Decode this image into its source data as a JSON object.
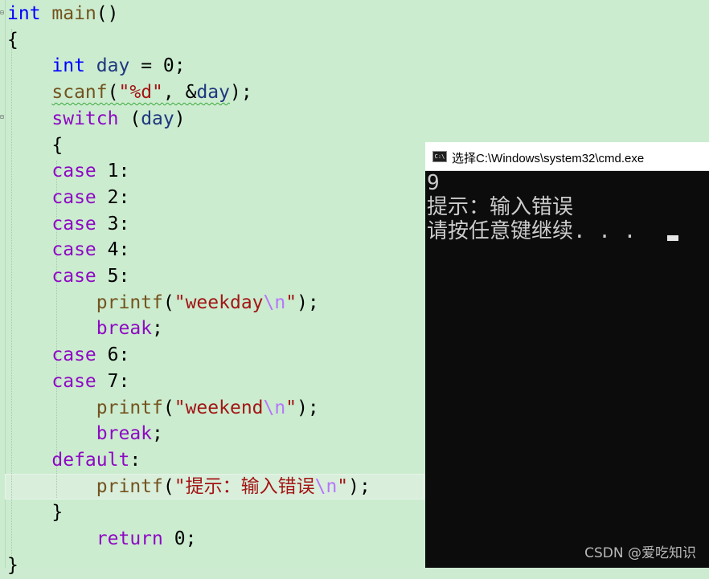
{
  "editor": {
    "lines": [
      [
        {
          "t": "int",
          "c": "kw-blue"
        },
        {
          "t": " "
        },
        {
          "t": "main",
          "c": "fn"
        },
        {
          "t": "()"
        }
      ],
      [
        {
          "t": "{"
        }
      ],
      [
        {
          "t": "    "
        },
        {
          "t": "int",
          "c": "kw-blue"
        },
        {
          "t": " "
        },
        {
          "t": "day",
          "c": "var"
        },
        {
          "t": " = 0;"
        }
      ],
      [
        {
          "t": "    "
        },
        {
          "t": "scanf",
          "c": "fn squiggle"
        },
        {
          "t": "(",
          "c": "squiggle"
        },
        {
          "t": "\"%d\"",
          "c": "str squiggle"
        },
        {
          "t": ", &",
          "c": "squiggle"
        },
        {
          "t": "day",
          "c": "var squiggle"
        },
        {
          "t": ");"
        }
      ],
      [
        {
          "t": "    "
        },
        {
          "t": "switch",
          "c": "kw-purple"
        },
        {
          "t": " ("
        },
        {
          "t": "day",
          "c": "var"
        },
        {
          "t": ")"
        }
      ],
      [
        {
          "t": "    {"
        }
      ],
      [
        {
          "t": "    "
        },
        {
          "t": "case",
          "c": "kw-purple"
        },
        {
          "t": " 1:"
        }
      ],
      [
        {
          "t": "    "
        },
        {
          "t": "case",
          "c": "kw-purple"
        },
        {
          "t": " 2:"
        }
      ],
      [
        {
          "t": "    "
        },
        {
          "t": "case",
          "c": "kw-purple"
        },
        {
          "t": " 3:"
        }
      ],
      [
        {
          "t": "    "
        },
        {
          "t": "case",
          "c": "kw-purple"
        },
        {
          "t": " 4:"
        }
      ],
      [
        {
          "t": "    "
        },
        {
          "t": "case",
          "c": "kw-purple"
        },
        {
          "t": " 5:"
        }
      ],
      [
        {
          "t": "        "
        },
        {
          "t": "printf",
          "c": "fn"
        },
        {
          "t": "("
        },
        {
          "t": "\"weekday",
          "c": "str"
        },
        {
          "t": "\\n",
          "c": "esc"
        },
        {
          "t": "\"",
          "c": "str"
        },
        {
          "t": ");"
        }
      ],
      [
        {
          "t": "        "
        },
        {
          "t": "break",
          "c": "kw-purple"
        },
        {
          "t": ";"
        }
      ],
      [
        {
          "t": "    "
        },
        {
          "t": "case",
          "c": "kw-purple"
        },
        {
          "t": " 6:"
        }
      ],
      [
        {
          "t": "    "
        },
        {
          "t": "case",
          "c": "kw-purple"
        },
        {
          "t": " 7:"
        }
      ],
      [
        {
          "t": "        "
        },
        {
          "t": "printf",
          "c": "fn"
        },
        {
          "t": "("
        },
        {
          "t": "\"weekend",
          "c": "str"
        },
        {
          "t": "\\n",
          "c": "esc"
        },
        {
          "t": "\"",
          "c": "str"
        },
        {
          "t": ");"
        }
      ],
      [
        {
          "t": "        "
        },
        {
          "t": "break",
          "c": "kw-purple"
        },
        {
          "t": ";"
        }
      ],
      [
        {
          "t": "    "
        },
        {
          "t": "default",
          "c": "kw-purple"
        },
        {
          "t": ":"
        }
      ],
      [
        {
          "t": "        "
        },
        {
          "t": "printf",
          "c": "fn"
        },
        {
          "t": "("
        },
        {
          "t": "\"提示：输入错误",
          "c": "str"
        },
        {
          "t": "\\n",
          "c": "esc"
        },
        {
          "t": "\"",
          "c": "str"
        },
        {
          "t": ");"
        }
      ],
      [
        {
          "t": "    }"
        }
      ],
      [
        {
          "t": "        "
        },
        {
          "t": "return",
          "c": "kw-purple"
        },
        {
          "t": " 0;"
        }
      ],
      [
        {
          "t": "}"
        }
      ]
    ]
  },
  "console": {
    "title": "选择C:\\Windows\\system32\\cmd.exe",
    "icon": "cmd-icon",
    "lines": [
      "9",
      "提示：输入错误",
      "请按任意键继续. . . "
    ]
  },
  "watermark": "CSDN @爱吃知识"
}
